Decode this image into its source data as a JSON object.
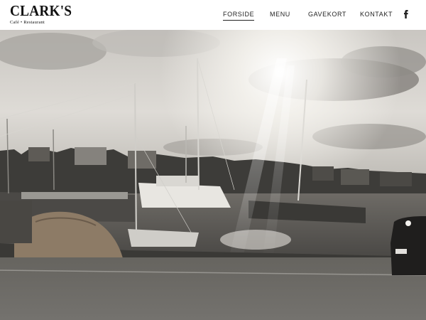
{
  "header": {
    "logo": {
      "main": "CLARK'S",
      "sub": "Café • Restaurant"
    },
    "nav": [
      {
        "label": "FORSIDE",
        "active": true
      },
      {
        "label": "MENU",
        "active": false
      },
      {
        "label": "GAVEKORT",
        "active": false
      },
      {
        "label": "KONTAKT",
        "active": false
      }
    ],
    "social_icon": "facebook-icon"
  },
  "hero": {
    "image": "harbor-sunset-photo",
    "accent_colors": {
      "sky": "#d9d6d1",
      "water": "#5d5b57",
      "road": "#6f6d69"
    }
  }
}
